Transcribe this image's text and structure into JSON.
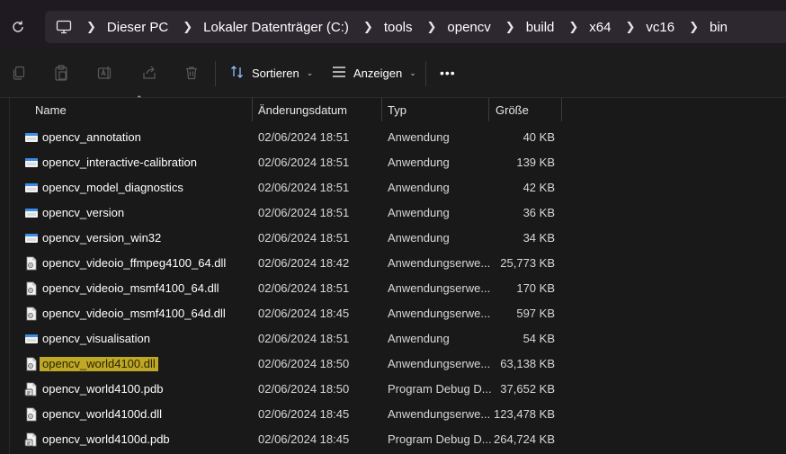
{
  "breadcrumb": {
    "items": [
      "Dieser PC",
      "Lokaler Datenträger (C:)",
      "tools",
      "opencv",
      "build",
      "x64",
      "vc16",
      "bin"
    ]
  },
  "toolbar": {
    "sort_label": "Sortieren",
    "view_label": "Anzeigen",
    "more_label": "•••"
  },
  "columns": {
    "name": "Name",
    "date": "Änderungsdatum",
    "type": "Typ",
    "size": "Größe"
  },
  "files": [
    {
      "name": "opencv_annotation",
      "date": "02/06/2024 18:51",
      "type": "Anwendung",
      "size": "40 KB",
      "icon": "exe"
    },
    {
      "name": "opencv_interactive-calibration",
      "date": "02/06/2024 18:51",
      "type": "Anwendung",
      "size": "139 KB",
      "icon": "exe"
    },
    {
      "name": "opencv_model_diagnostics",
      "date": "02/06/2024 18:51",
      "type": "Anwendung",
      "size": "42 KB",
      "icon": "exe"
    },
    {
      "name": "opencv_version",
      "date": "02/06/2024 18:51",
      "type": "Anwendung",
      "size": "36 KB",
      "icon": "exe"
    },
    {
      "name": "opencv_version_win32",
      "date": "02/06/2024 18:51",
      "type": "Anwendung",
      "size": "34 KB",
      "icon": "exe"
    },
    {
      "name": "opencv_videoio_ffmpeg4100_64.dll",
      "date": "02/06/2024 18:42",
      "type": "Anwendungserwe...",
      "size": "25,773 KB",
      "icon": "dll"
    },
    {
      "name": "opencv_videoio_msmf4100_64.dll",
      "date": "02/06/2024 18:51",
      "type": "Anwendungserwe...",
      "size": "170 KB",
      "icon": "dll"
    },
    {
      "name": "opencv_videoio_msmf4100_64d.dll",
      "date": "02/06/2024 18:45",
      "type": "Anwendungserwe...",
      "size": "597 KB",
      "icon": "dll"
    },
    {
      "name": "opencv_visualisation",
      "date": "02/06/2024 18:51",
      "type": "Anwendung",
      "size": "54 KB",
      "icon": "exe"
    },
    {
      "name": "opencv_world4100.dll",
      "date": "02/06/2024 18:50",
      "type": "Anwendungserwe...",
      "size": "63,138 KB",
      "icon": "dll",
      "highlight": true
    },
    {
      "name": "opencv_world4100.pdb",
      "date": "02/06/2024 18:50",
      "type": "Program Debug D...",
      "size": "37,652 KB",
      "icon": "pdb"
    },
    {
      "name": "opencv_world4100d.dll",
      "date": "02/06/2024 18:45",
      "type": "Anwendungserwe...",
      "size": "123,478 KB",
      "icon": "dll"
    },
    {
      "name": "opencv_world4100d.pdb",
      "date": "02/06/2024 18:45",
      "type": "Program Debug D...",
      "size": "264,724 KB",
      "icon": "pdb"
    }
  ],
  "colors": {
    "highlight": "#bfa825",
    "exe_icon": "#3a8ee6"
  }
}
